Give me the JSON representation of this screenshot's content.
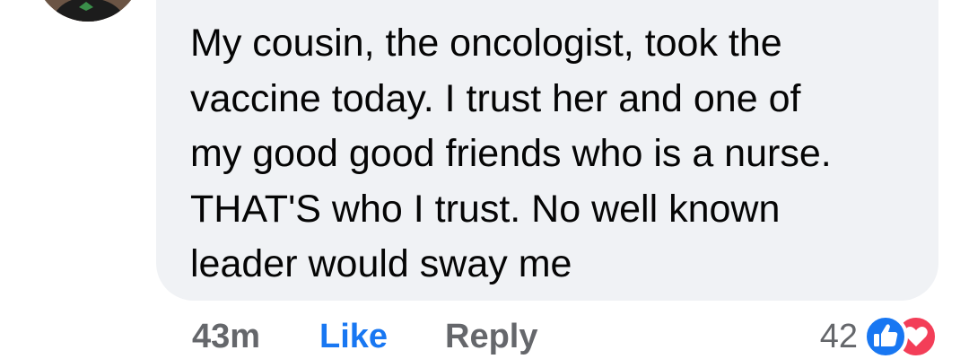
{
  "comment": {
    "text": "My cousin, the oncologist, took the\nvaccine today. I trust her and one of\nmy good good friends who is a nurse.\nTHAT'S who I trust. No well known\nleader would sway me",
    "timestamp": "43m",
    "like_label": "Like",
    "reply_label": "Reply",
    "reaction_count": "42",
    "reactions": [
      "like-icon",
      "love-icon"
    ]
  },
  "colors": {
    "bubble": "#f0f2f5",
    "text": "#050505",
    "meta": "#65676b",
    "like_blue": "#1877f2",
    "love_red": "#f33e58"
  }
}
